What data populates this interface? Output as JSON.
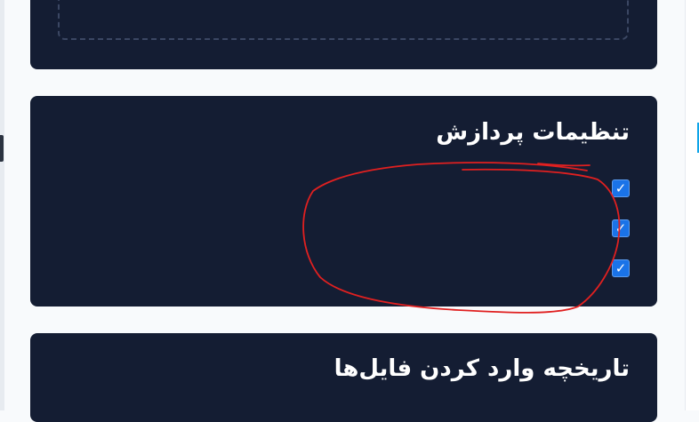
{
  "upload": {
    "hint": ""
  },
  "processing": {
    "title": "تنظیمات پردازش",
    "options": [
      {
        "label": "",
        "checked": true
      },
      {
        "label": "",
        "checked": true
      },
      {
        "label": "",
        "checked": true
      }
    ],
    "check_glyph": "✓"
  },
  "history": {
    "title": "تاریخچه وارد کردن فایل‌ها"
  },
  "colors": {
    "page_background": "#f8fafc",
    "card_background": "#141d33",
    "checkbox_accent": "#1a73e8",
    "annotation_stroke": "#e02020",
    "sidebar_marker": "#0ea5e9"
  },
  "icons": {
    "checkbox": "checkmark-icon"
  }
}
